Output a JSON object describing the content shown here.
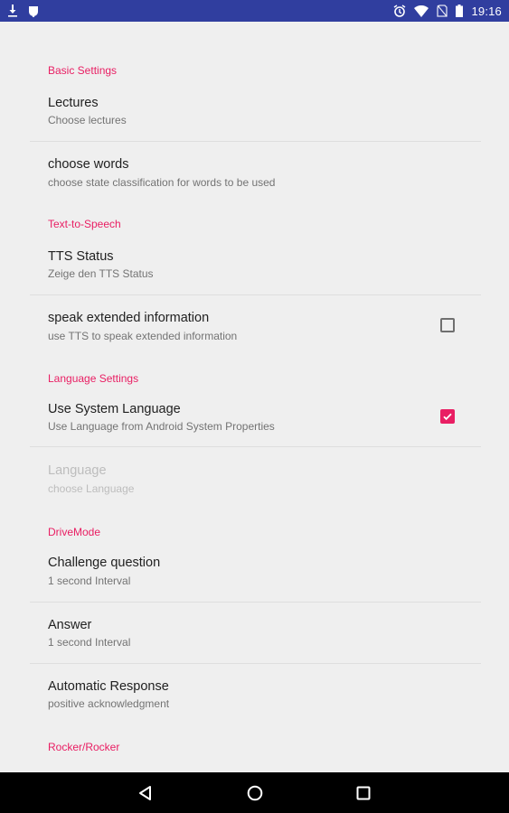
{
  "status_bar": {
    "time": "19:16",
    "left_icons": [
      "download-icon",
      "android-debug-icon"
    ],
    "right_icons": [
      "alarm-icon",
      "wifi-icon",
      "no-sim-icon",
      "battery-icon"
    ],
    "color": "#303e9f"
  },
  "sections": {
    "basic": "Basic Settings",
    "tts": "Text-to-Speech",
    "language": "Language Settings",
    "drive": "DriveMode",
    "next_partial": "Rocker/Rocker"
  },
  "prefs": {
    "lectures": {
      "title": "Lectures",
      "summary": "Choose lectures"
    },
    "choose_words": {
      "title": "choose words",
      "summary": "choose state classification for words to be used"
    },
    "tts_status": {
      "title": "TTS Status",
      "summary": "Zeige den TTS Status"
    },
    "speak_extended": {
      "title": "speak extended information",
      "summary": "use TTS to speak extended information",
      "checked": false
    },
    "use_system_language": {
      "title": "Use System Language",
      "summary": "Use Language from Android System Properties",
      "checked": true
    },
    "language": {
      "title": "Language",
      "summary": "choose Language",
      "enabled": false
    },
    "challenge_question": {
      "title": "Challenge question",
      "summary": "1 second Interval"
    },
    "answer": {
      "title": "Answer",
      "summary": "1 second Interval"
    },
    "automatic_response": {
      "title": "Automatic Response",
      "summary": "positive acknowledgment"
    }
  },
  "colors": {
    "accent": "#e91e63",
    "background": "#efefef",
    "nav_bar": "#000000"
  },
  "nav_bar": {
    "buttons": [
      "back-icon",
      "home-icon",
      "recents-icon"
    ]
  }
}
